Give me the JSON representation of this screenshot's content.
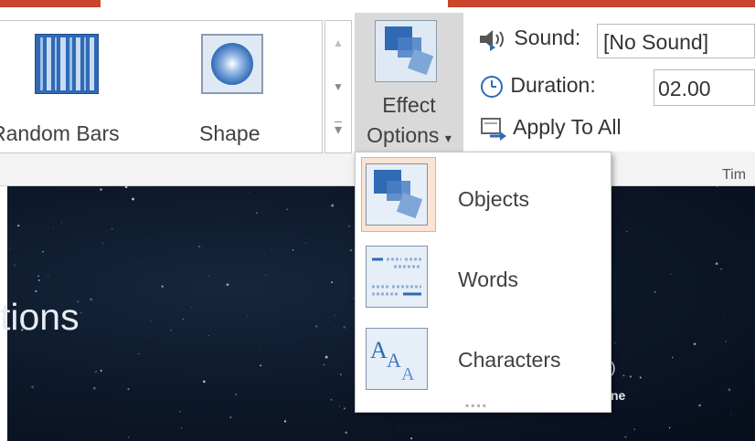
{
  "gallery": {
    "items": [
      {
        "label": "Random Bars",
        "icon": "random-bars-icon"
      },
      {
        "label": "Shape",
        "icon": "shape-icon"
      }
    ],
    "scroll_up": "▲",
    "scroll_down": "▼",
    "more": "▾"
  },
  "effect_options": {
    "line1": "Effect",
    "line2": "Options",
    "caret": "▾"
  },
  "timing": {
    "sound_label": "Sound:",
    "sound_value": "[No Sound]",
    "duration_label": "Duration:",
    "duration_value": "02.00",
    "apply_label": "Apply To All",
    "group_label": "Tim"
  },
  "slide": {
    "title_fragment": "tions",
    "peek_text_1": ")",
    "peek_text_2": "ne"
  },
  "dropdown": {
    "items": [
      {
        "label": "Objects",
        "icon": "objects-icon",
        "selected": true
      },
      {
        "label": "Words",
        "icon": "words-icon",
        "selected": false
      },
      {
        "label": "Characters",
        "icon": "characters-icon",
        "selected": false
      }
    ],
    "resize_handle": "▪▪▪▪"
  },
  "colors": {
    "accent": "#c9462c",
    "ribbon_button_pressed": "#d9d9d9",
    "selection_highlight": "#fde3d4",
    "icon_blue": "#2f6ab5"
  }
}
